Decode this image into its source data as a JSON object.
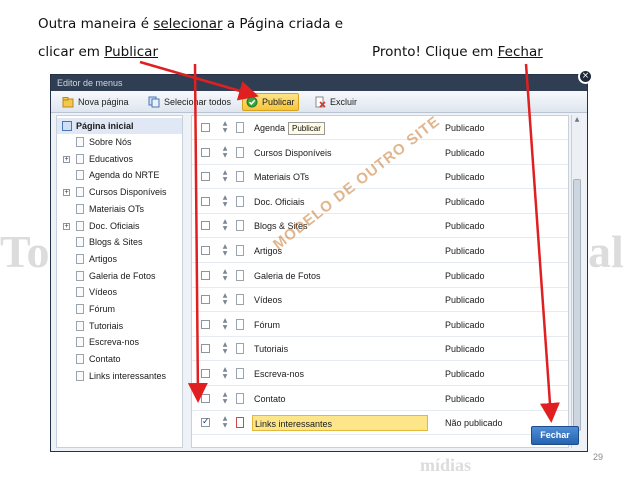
{
  "captions": {
    "line1_pre": "Outra maneira é ",
    "line1_link": "selecionar",
    "line1_post": " a Página criada e",
    "line2_pre": "clicar em ",
    "line2_link": "Publicar",
    "right_pre": "Pronto! Clique em ",
    "right_link": "Fechar"
  },
  "background": {
    "left_big": "To",
    "right_big": "al",
    "bottom_text": "mídias"
  },
  "window": {
    "title": "Editor de menus",
    "close_glyph": "×"
  },
  "toolbar": {
    "nova_pagina": "Nova página",
    "selecionar_todos": "Selecionar todos",
    "publicar": "Publicar",
    "excluir": "Excluir"
  },
  "tooltip": "Publicar",
  "tree": {
    "root": "Página inicial",
    "items": [
      {
        "label": "Sobre Nós",
        "expandable": false
      },
      {
        "label": "Educativos",
        "expandable": true
      },
      {
        "label": "Agenda do NRTE",
        "expandable": false
      },
      {
        "label": "Cursos Disponíveis",
        "expandable": true
      },
      {
        "label": "Materiais OTs",
        "expandable": false
      },
      {
        "label": "Doc. Oficiais",
        "expandable": true
      },
      {
        "label": "Blogs & Sites",
        "expandable": false
      },
      {
        "label": "Artigos",
        "expandable": false
      },
      {
        "label": "Galeria de Fotos",
        "expandable": false
      },
      {
        "label": "Vídeos",
        "expandable": false
      },
      {
        "label": "Fórum",
        "expandable": false
      },
      {
        "label": "Tutoriais",
        "expandable": false
      },
      {
        "label": "Escreva-nos",
        "expandable": false
      },
      {
        "label": "Contato",
        "expandable": false
      },
      {
        "label": "Links interessantes",
        "expandable": false
      }
    ]
  },
  "rows": [
    {
      "name": "Agenda",
      "status": "Publicado",
      "checked": false
    },
    {
      "name": "Cursos Disponíveis",
      "status": "Publicado",
      "checked": false
    },
    {
      "name": "Materiais OTs",
      "status": "Publicado",
      "checked": false
    },
    {
      "name": "Doc. Oficiais",
      "status": "Publicado",
      "checked": false
    },
    {
      "name": "Blogs & Sites",
      "status": "Publicado",
      "checked": false
    },
    {
      "name": "Artigos",
      "status": "Publicado",
      "checked": false
    },
    {
      "name": "Galeria de Fotos",
      "status": "Publicado",
      "checked": false
    },
    {
      "name": "Vídeos",
      "status": "Publicado",
      "checked": false
    },
    {
      "name": "Fórum",
      "status": "Publicado",
      "checked": false
    },
    {
      "name": "Tutoriais",
      "status": "Publicado",
      "checked": false
    },
    {
      "name": "Escreva-nos",
      "status": "Publicado",
      "checked": false
    },
    {
      "name": "Contato",
      "status": "Publicado",
      "checked": false
    },
    {
      "name": "Links interessantes",
      "status": "Não publicado",
      "checked": true
    }
  ],
  "checkmark_glyph": "✓",
  "arrow_glyphs": "▲▼",
  "fechar": "Fechar",
  "watermark": "MODELO DE OUTRO SITE",
  "page_number": "29",
  "colors": {
    "annotation_arrow": "#e02020",
    "highlight": "#fde58a",
    "button_blue": "#2563b0",
    "title_bar": "#2f3e52"
  }
}
